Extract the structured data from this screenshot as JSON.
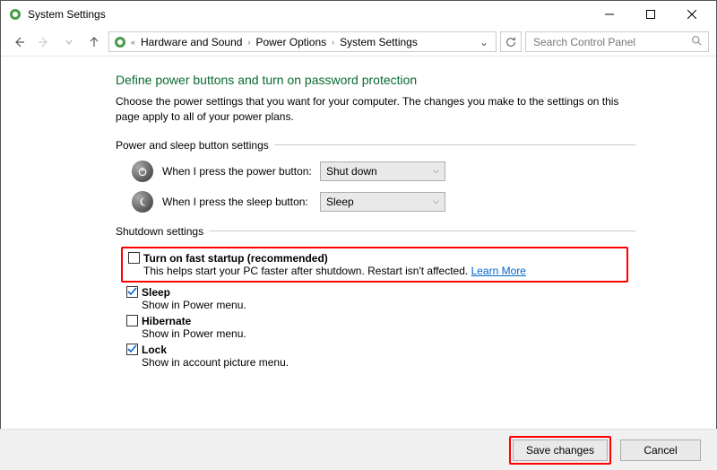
{
  "window": {
    "title": "System Settings"
  },
  "breadcrumb": {
    "items": [
      "Hardware and Sound",
      "Power Options",
      "System Settings"
    ]
  },
  "search": {
    "placeholder": "Search Control Panel"
  },
  "page": {
    "heading": "Define power buttons and turn on password protection",
    "description": "Choose the power settings that you want for your computer. The changes you make to the settings on this page apply to all of your power plans."
  },
  "power_buttons": {
    "group_label": "Power and sleep button settings",
    "rows": [
      {
        "label": "When I press the power button:",
        "value": "Shut down"
      },
      {
        "label": "When I press the sleep button:",
        "value": "Sleep"
      }
    ]
  },
  "shutdown": {
    "group_label": "Shutdown settings",
    "fast_startup": {
      "label": "Turn on fast startup (recommended)",
      "desc": "This helps start your PC faster after shutdown. Restart isn't affected. ",
      "learn_more": "Learn More",
      "checked": false
    },
    "sleep": {
      "label": "Sleep",
      "desc": "Show in Power menu.",
      "checked": true
    },
    "hibernate": {
      "label": "Hibernate",
      "desc": "Show in Power menu.",
      "checked": false
    },
    "lock": {
      "label": "Lock",
      "desc": "Show in account picture menu.",
      "checked": true
    }
  },
  "footer": {
    "save": "Save changes",
    "cancel": "Cancel"
  }
}
